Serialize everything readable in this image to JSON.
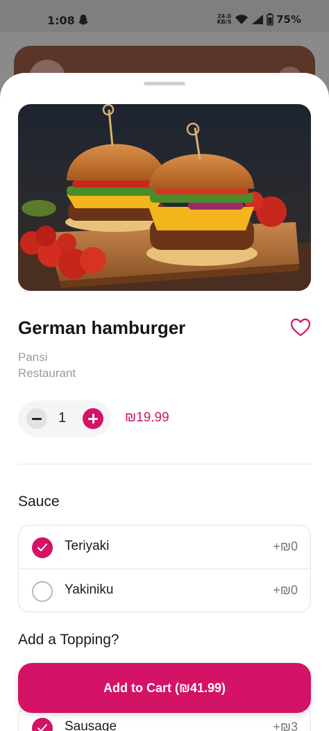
{
  "status_bar": {
    "time": "1:08",
    "net_speed_value": "24.0",
    "net_speed_unit": "KB/S",
    "battery": "75%"
  },
  "product": {
    "title": "German hamburger",
    "restaurant_line1": "Pansi",
    "restaurant_line2": "Restaurant",
    "quantity": "1",
    "price": "₪19.99",
    "image_icon": "burger-photo"
  },
  "sauce": {
    "title": "Sauce",
    "options": [
      {
        "label": "Teriyaki",
        "price": "+₪0",
        "selected": true
      },
      {
        "label": "Yakiniku",
        "price": "+₪0",
        "selected": false
      }
    ]
  },
  "topping": {
    "title": "Add a Topping?",
    "options": [
      {
        "label": "Sausage",
        "price": "+₪3",
        "selected": true
      }
    ]
  },
  "cart": {
    "label": "Add to Cart (₪41.99)"
  },
  "colors": {
    "accent": "#d41366",
    "muted_text": "#9a9a9a"
  }
}
